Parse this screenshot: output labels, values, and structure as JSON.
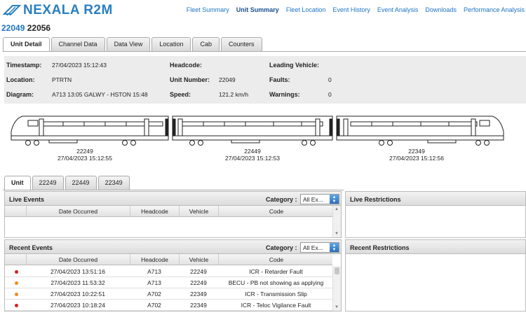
{
  "app": {
    "logo": "NEXALA R2M"
  },
  "nav": [
    {
      "label": "Fleet Summary",
      "active": false
    },
    {
      "label": "Unit Summary",
      "active": true
    },
    {
      "label": "Fleet Location",
      "active": false
    },
    {
      "label": "Event History",
      "active": false
    },
    {
      "label": "Event Analysis",
      "active": false
    },
    {
      "label": "Downloads",
      "active": false
    },
    {
      "label": "Performance Analysis",
      "active": false
    }
  ],
  "unit": {
    "primary": "22049",
    "secondary": "22056"
  },
  "tabs": [
    {
      "label": "Unit Detail",
      "active": true
    },
    {
      "label": "Channel Data"
    },
    {
      "label": "Data View"
    },
    {
      "label": "Location"
    },
    {
      "label": "Cab"
    },
    {
      "label": "Counters"
    }
  ],
  "info": {
    "timestamp_label": "Timestamp:",
    "timestamp": "27/04/2023 15:12:43",
    "location_label": "Location:",
    "location": "PTRTN",
    "diagram_label": "Diagram:",
    "diagram": "A713 13:05 GALWY - HSTON 15:48",
    "headcode_label": "Headcode:",
    "headcode": "",
    "unit_number_label": "Unit Number:",
    "unit_number": "22049",
    "speed_label": "Speed:",
    "speed": "121.2 km/h",
    "leading_vehicle_label": "Leading Vehicle:",
    "leading_vehicle": "",
    "faults_label": "Faults:",
    "faults": "0",
    "warnings_label": "Warnings:",
    "warnings": "0"
  },
  "vehicles": [
    {
      "id": "22249",
      "time": "27/04/2023 15:12:55"
    },
    {
      "id": "22449",
      "time": "27/04/2023 15:12:53"
    },
    {
      "id": "22349",
      "time": "27/04/2023 15:12:56"
    }
  ],
  "subtabs": [
    {
      "label": "Unit",
      "active": true
    },
    {
      "label": "22249"
    },
    {
      "label": "22449"
    },
    {
      "label": "22349"
    }
  ],
  "live_events": {
    "title": "Live Events",
    "category_label": "Category :",
    "category_value": "All Ex...",
    "columns": [
      "Date Occurred",
      "Headcode",
      "Vehicle",
      "Code"
    ]
  },
  "recent_events": {
    "title": "Recent Events",
    "category_label": "Category :",
    "category_value": "All Ex...",
    "columns": [
      "Date Occurred",
      "Headcode",
      "Vehicle",
      "Code"
    ],
    "rows": [
      {
        "date": "27/04/2023 13:51:16",
        "headcode": "A713",
        "vehicle": "22249",
        "code": "ICR - Retarder Fault",
        "color": "#d81e1e"
      },
      {
        "date": "27/04/2023 11:53:32",
        "headcode": "A713",
        "vehicle": "22249",
        "code": "BECU - PB not showing as applying",
        "color": "#f08a1c"
      },
      {
        "date": "27/04/2023 10:22:51",
        "headcode": "A702",
        "vehicle": "22349",
        "code": "ICR - Transmission Slip",
        "color": "#f08a1c"
      },
      {
        "date": "27/04/2023 10:18:24",
        "headcode": "A702",
        "vehicle": "22349",
        "code": "ICR - Teloc Vigilance Fault",
        "color": "#d81e1e"
      }
    ]
  },
  "live_restrictions": {
    "title": "Live Restrictions"
  },
  "recent_restrictions": {
    "title": "Recent Restrictions"
  }
}
